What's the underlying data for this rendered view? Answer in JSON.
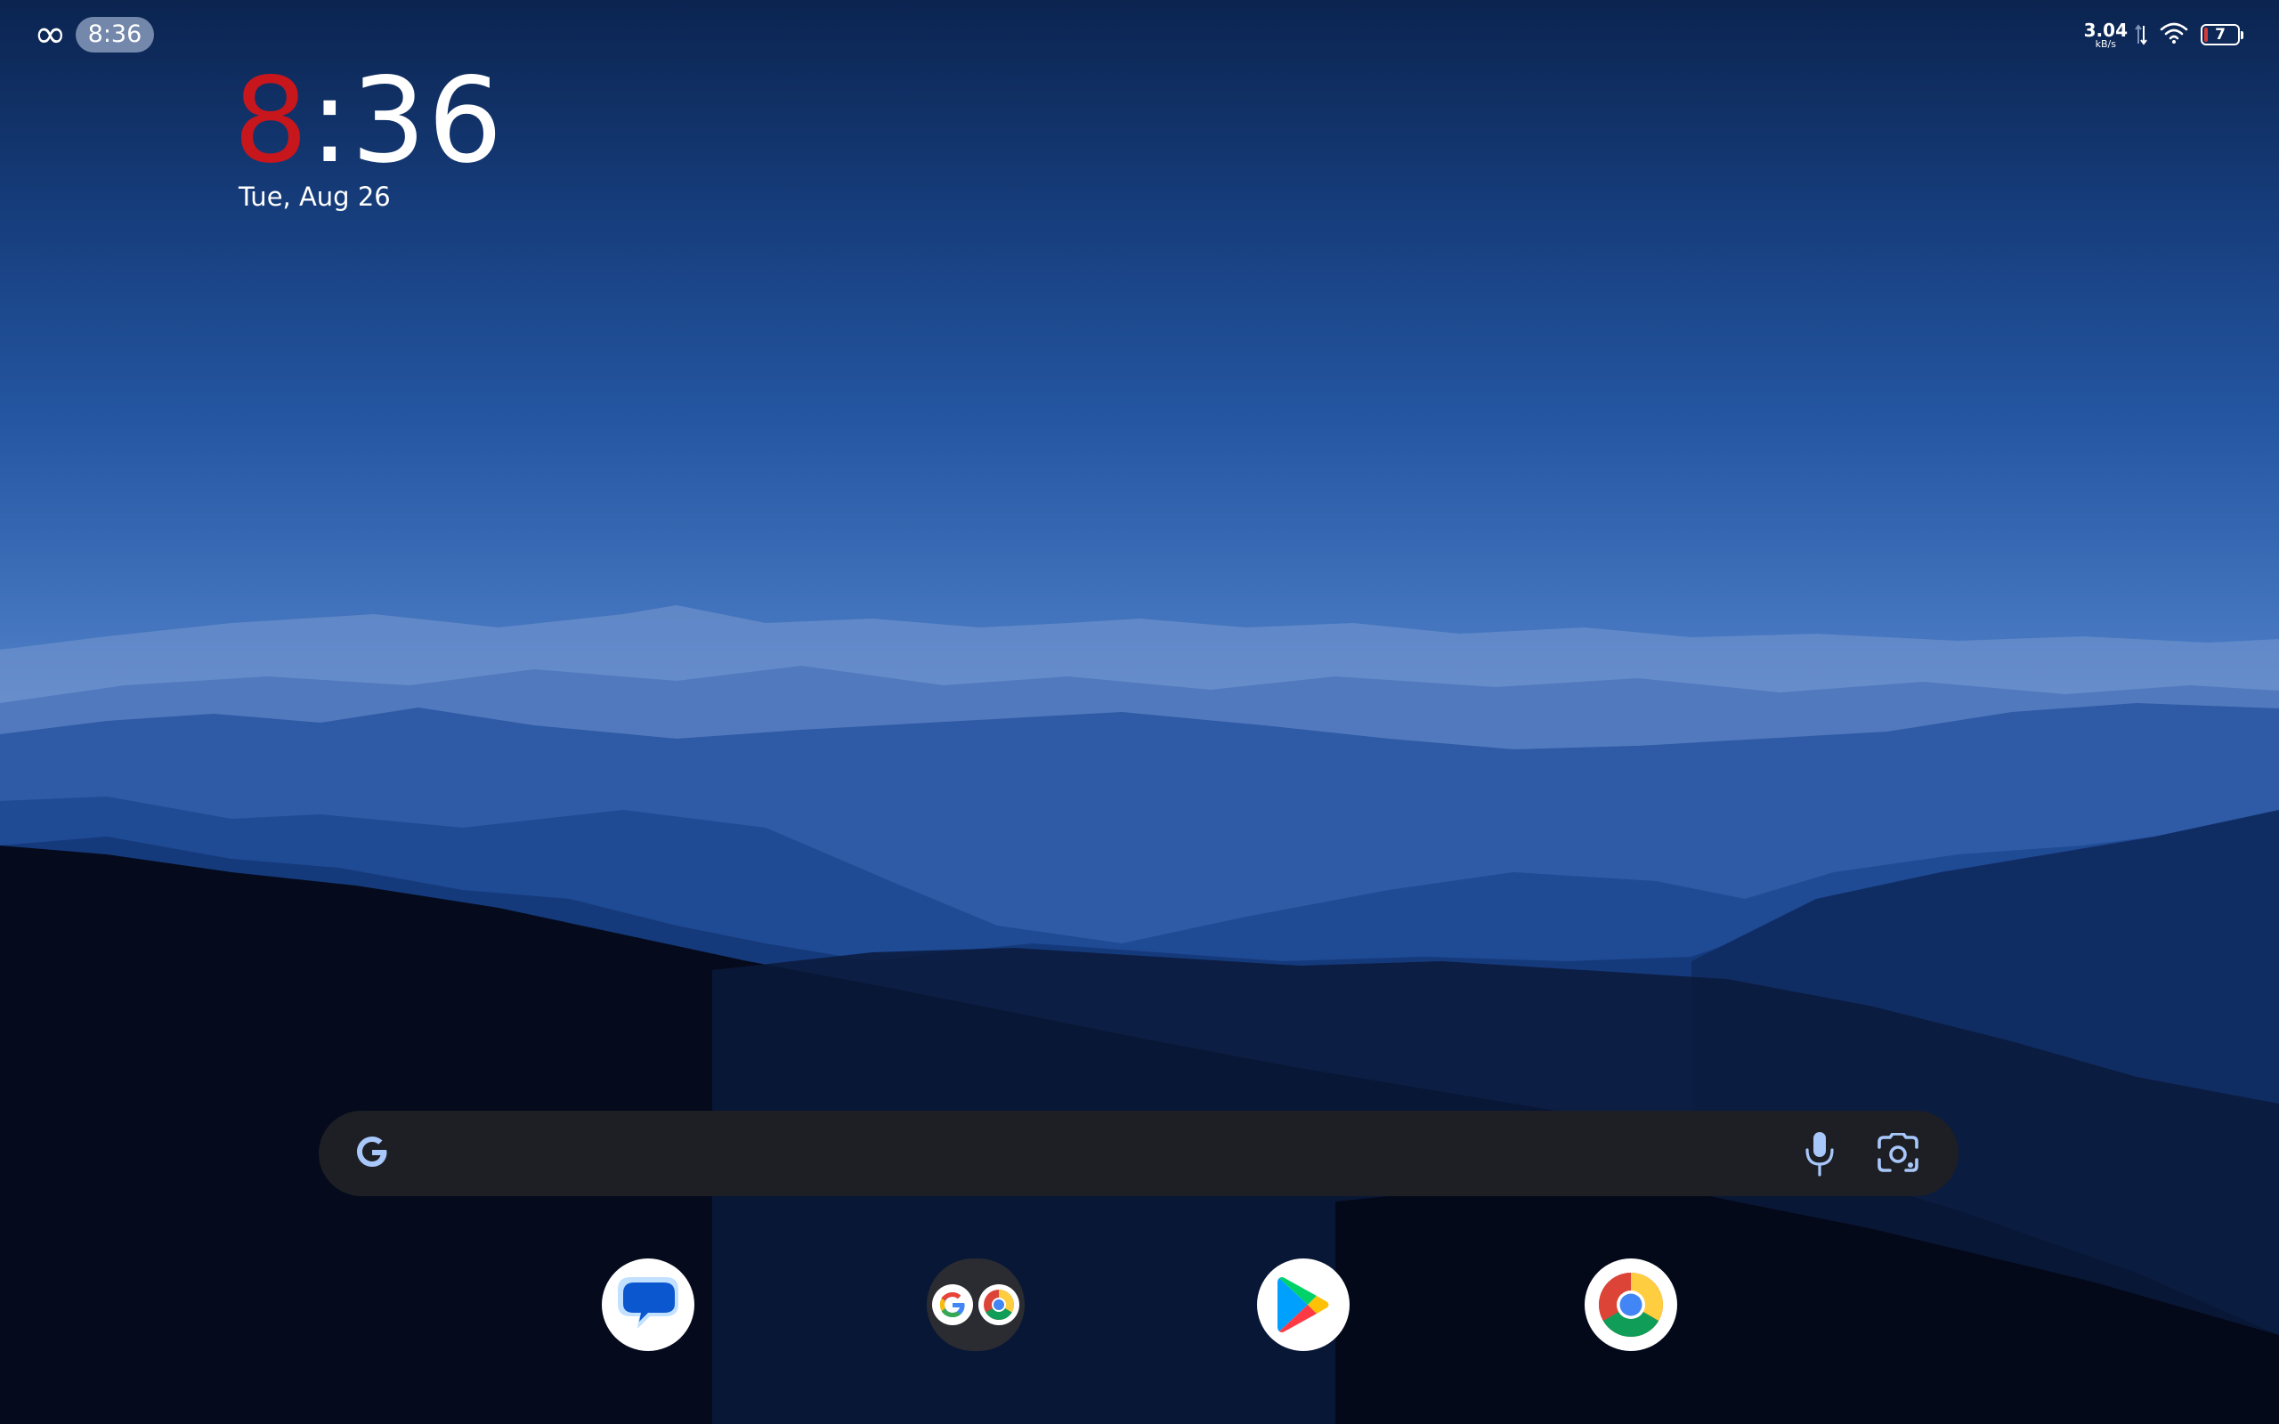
{
  "status_bar": {
    "left_icon": "infinity-icon",
    "time": "8:36",
    "net_speed_value": "3.04",
    "net_speed_unit": "kB/s",
    "wifi_icon": "wifi-icon",
    "battery_level": "7",
    "battery_fraction": 0.07,
    "battery_color": "#d33a3a"
  },
  "clock_widget": {
    "hour": "8",
    "separator": ":",
    "minutes": "36",
    "date": "Tue, Aug 26",
    "hour_color": "#c8161d"
  },
  "search_bar": {
    "logo_icon": "google-g-icon",
    "placeholder": "",
    "mic_icon": "microphone-icon",
    "lens_icon": "google-lens-icon"
  },
  "dock": {
    "apps": [
      {
        "icon": "messages-icon"
      },
      {
        "icon": "google-apps-folder-icon"
      },
      {
        "icon": "play-store-icon"
      },
      {
        "icon": "chrome-icon"
      }
    ]
  },
  "wallpaper": "mountain-range-wallpaper"
}
